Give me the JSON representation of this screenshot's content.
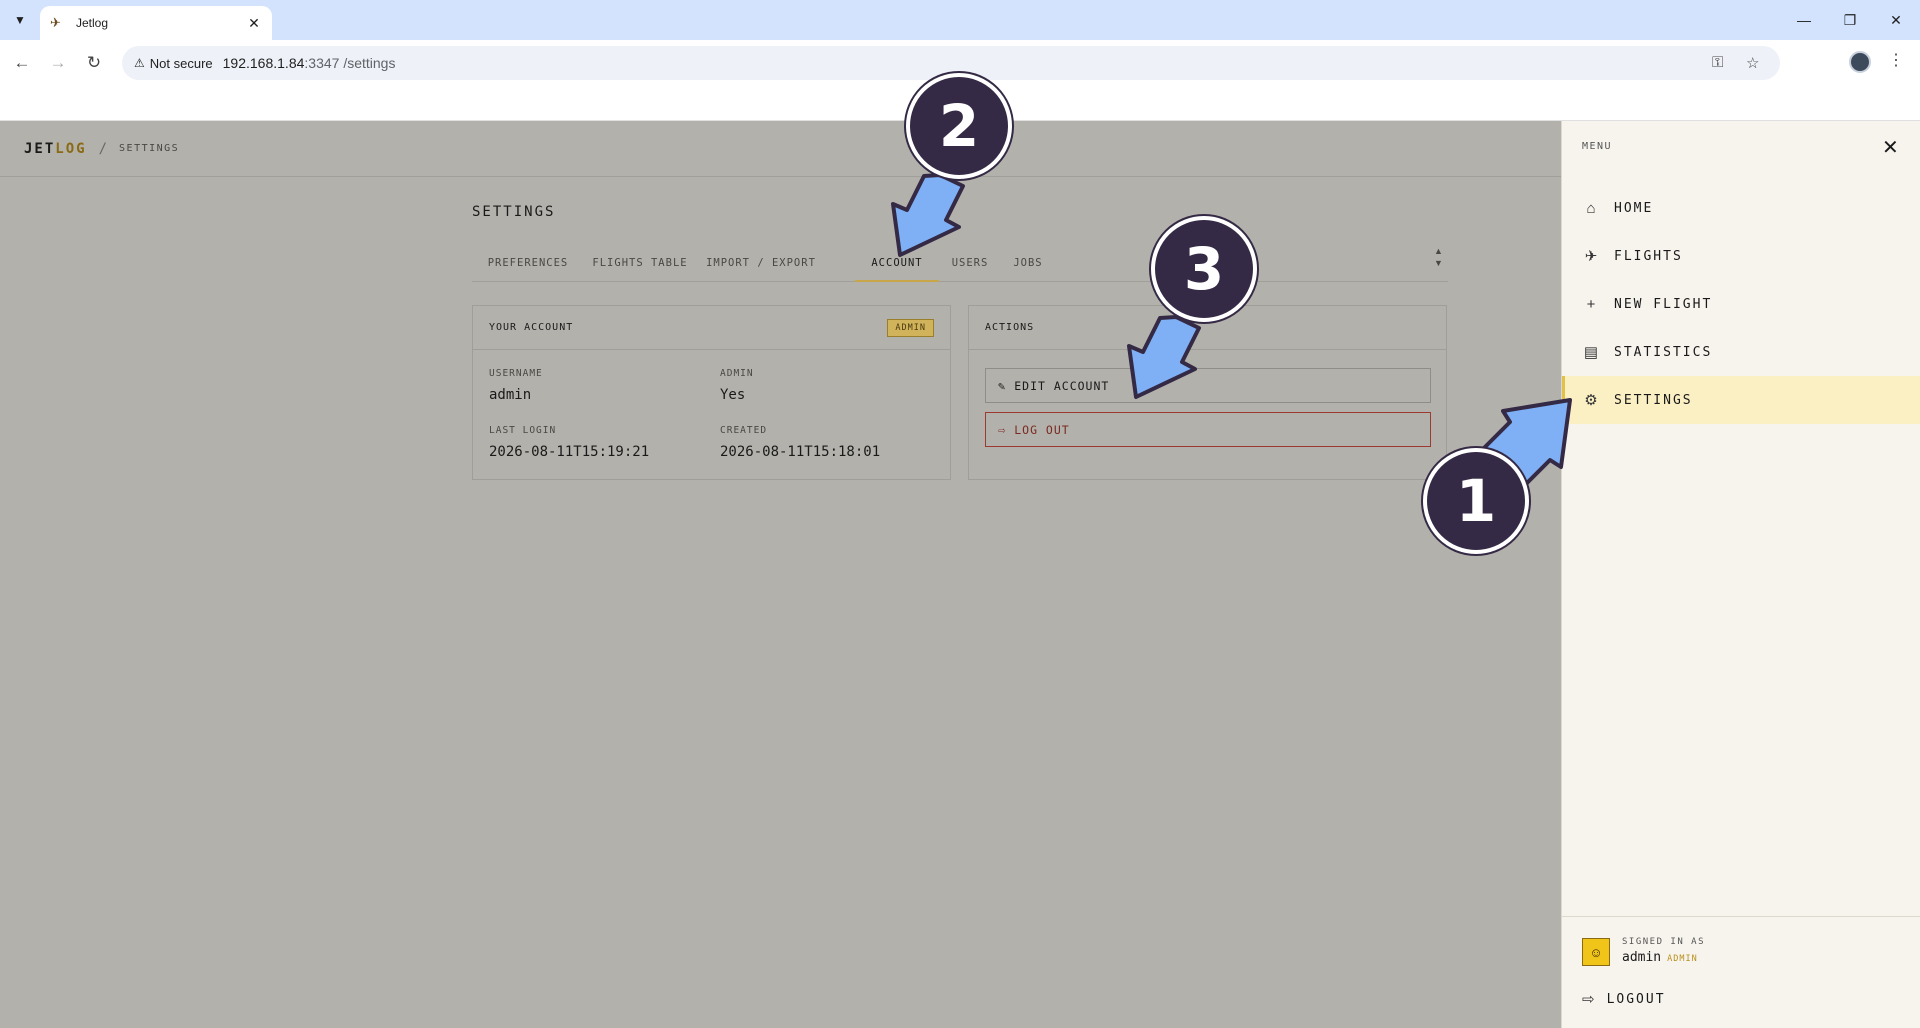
{
  "browser": {
    "tab_title": "Jetlog",
    "security_label": "Not secure",
    "url_host": "192.168.1.84",
    "url_rest": ":3347 /settings"
  },
  "app": {
    "brand_jet": "JET",
    "brand_log": "LOG",
    "breadcrumb_sep": "/",
    "breadcrumb": "SETTINGS",
    "page_title": "SETTINGS",
    "tabs": [
      {
        "label": "PREFERENCES"
      },
      {
        "label": "FLIGHTS TABLE"
      },
      {
        "label": "IMPORT / EXPORT"
      },
      {
        "label": "ACCOUNT",
        "active": true
      },
      {
        "label": "USERS"
      },
      {
        "label": "JOBS"
      }
    ],
    "account_card": {
      "title": "YOUR ACCOUNT",
      "badge": "ADMIN",
      "username_label": "USERNAME",
      "username": "admin",
      "admin_label": "ADMIN",
      "admin": "Yes",
      "last_login_label": "LAST LOGIN",
      "last_login": "2026-08-11T15:19:21",
      "created_label": "CREATED",
      "created": "2026-08-11T15:18:01"
    },
    "actions_card": {
      "title": "ACTIONS",
      "edit_label": "EDIT ACCOUNT",
      "logout_label": "LOG OUT"
    }
  },
  "menu": {
    "label": "MENU",
    "items": [
      {
        "label": "HOME",
        "icon": "home-icon"
      },
      {
        "label": "FLIGHTS",
        "icon": "plane-icon"
      },
      {
        "label": "NEW FLIGHT",
        "icon": "plus-icon"
      },
      {
        "label": "STATISTICS",
        "icon": "bar-chart-icon"
      },
      {
        "label": "SETTINGS",
        "icon": "gear-icon",
        "active": true
      }
    ],
    "signed_in_label": "SIGNED IN AS",
    "user": "admin",
    "role": "ADMIN",
    "logout": "LOGOUT"
  },
  "annotations": {
    "step1": "1",
    "step2": "2",
    "step3": "3"
  },
  "colors": {
    "accent": "#c8a64a",
    "overlay": "#b3b1ab",
    "step_circle": "#352a45",
    "arrow": "#7fb0f5"
  }
}
